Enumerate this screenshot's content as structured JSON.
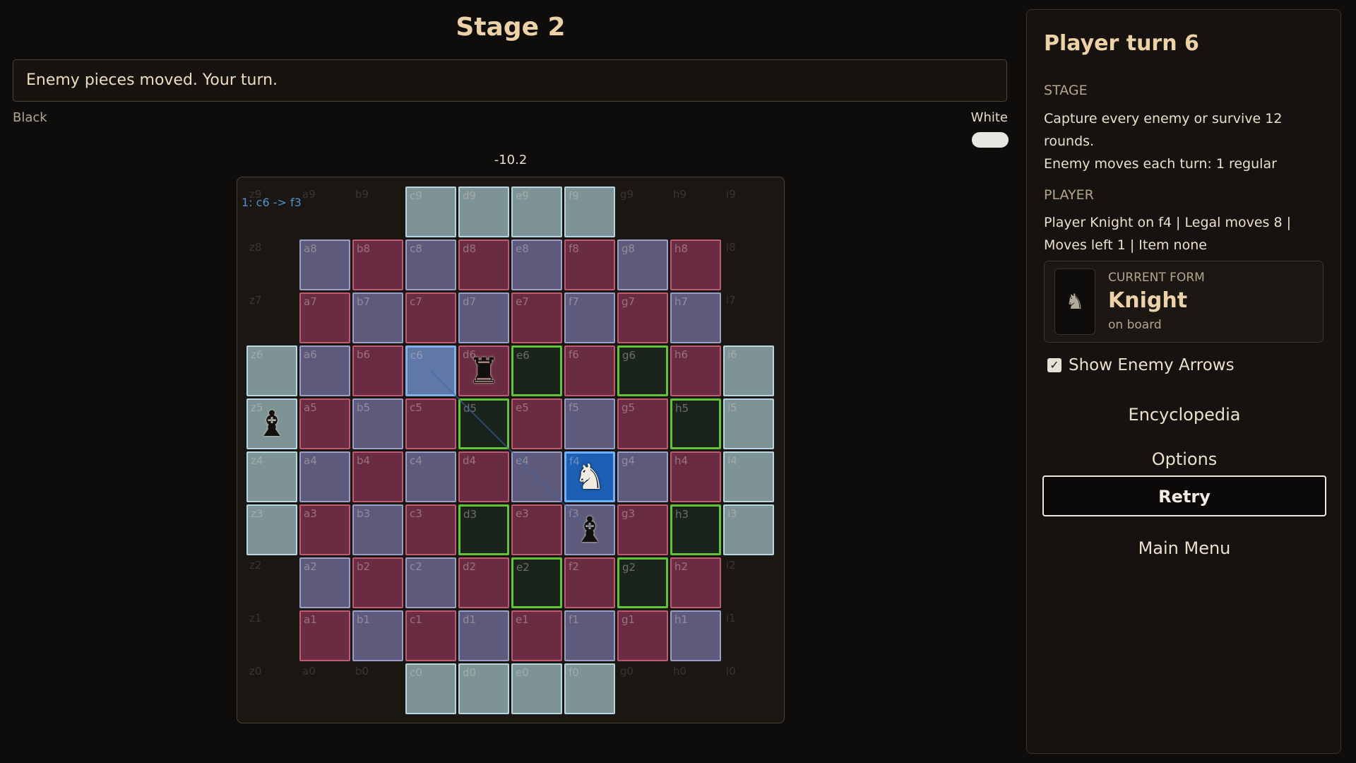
{
  "header": {
    "stage_title": "Stage 2",
    "message": "Enemy pieces moved. Your turn."
  },
  "sides": {
    "left": "Black",
    "right": "White",
    "toggle_state": "on"
  },
  "evaluation": "-10.2",
  "board": {
    "move_log": "1: c6 -> f3",
    "files": [
      "z",
      "a",
      "b",
      "c",
      "d",
      "e",
      "f",
      "g",
      "h",
      "i"
    ],
    "ranks": [
      "9",
      "8",
      "7",
      "6",
      "5",
      "4",
      "3",
      "2",
      "1",
      "0"
    ],
    "void_cells": [
      "z9",
      "a9",
      "b9",
      "g9",
      "h9",
      "i9",
      "z8",
      "i8",
      "z7",
      "i7",
      "z2",
      "i2",
      "z1",
      "i1",
      "z0",
      "a0",
      "b0",
      "g0",
      "h0",
      "i0"
    ],
    "teal_cells": [
      "c9",
      "d9",
      "e9",
      "f9",
      "z6",
      "i6",
      "z5",
      "i5",
      "z4",
      "i4",
      "z3",
      "i3",
      "c0",
      "d0",
      "e0",
      "f0"
    ],
    "move_targets": [
      "e6",
      "g6",
      "d5",
      "h5",
      "d3",
      "h3",
      "e2",
      "g2"
    ],
    "selected": "f4",
    "arrow_origin": "c6",
    "pieces": [
      {
        "square": "d6",
        "type": "rook",
        "glyph": "♜",
        "side": "enemy"
      },
      {
        "square": "z5",
        "type": "bishop",
        "glyph": "♝",
        "side": "enemy"
      },
      {
        "square": "f3",
        "type": "bishop",
        "glyph": "♝",
        "side": "enemy"
      },
      {
        "square": "f4",
        "type": "knight",
        "glyph": "♞",
        "side": "player"
      }
    ]
  },
  "panel": {
    "turn_title": "Player turn 6",
    "stage_heading": "STAGE",
    "stage_line1": "Capture every enemy or survive 12",
    "stage_line2": "rounds.",
    "stage_line3": "Enemy moves each turn: 1 regular",
    "player_heading": "PLAYER",
    "player_line1": "Player Knight on f4 | Legal moves 8 |",
    "player_line2": "Moves left 1 | Item none",
    "form": {
      "kicker": "CURRENT FORM",
      "name": "Knight",
      "status": "on board",
      "icon": "knight-icon",
      "glyph": "♞"
    },
    "checkbox": {
      "label": "Show Enemy Arrows",
      "checked": true,
      "mark": "✓"
    },
    "buttons": {
      "encyclopedia": "Encyclopedia",
      "options": "Options",
      "retry": "Retry",
      "main_menu": "Main Menu"
    }
  }
}
